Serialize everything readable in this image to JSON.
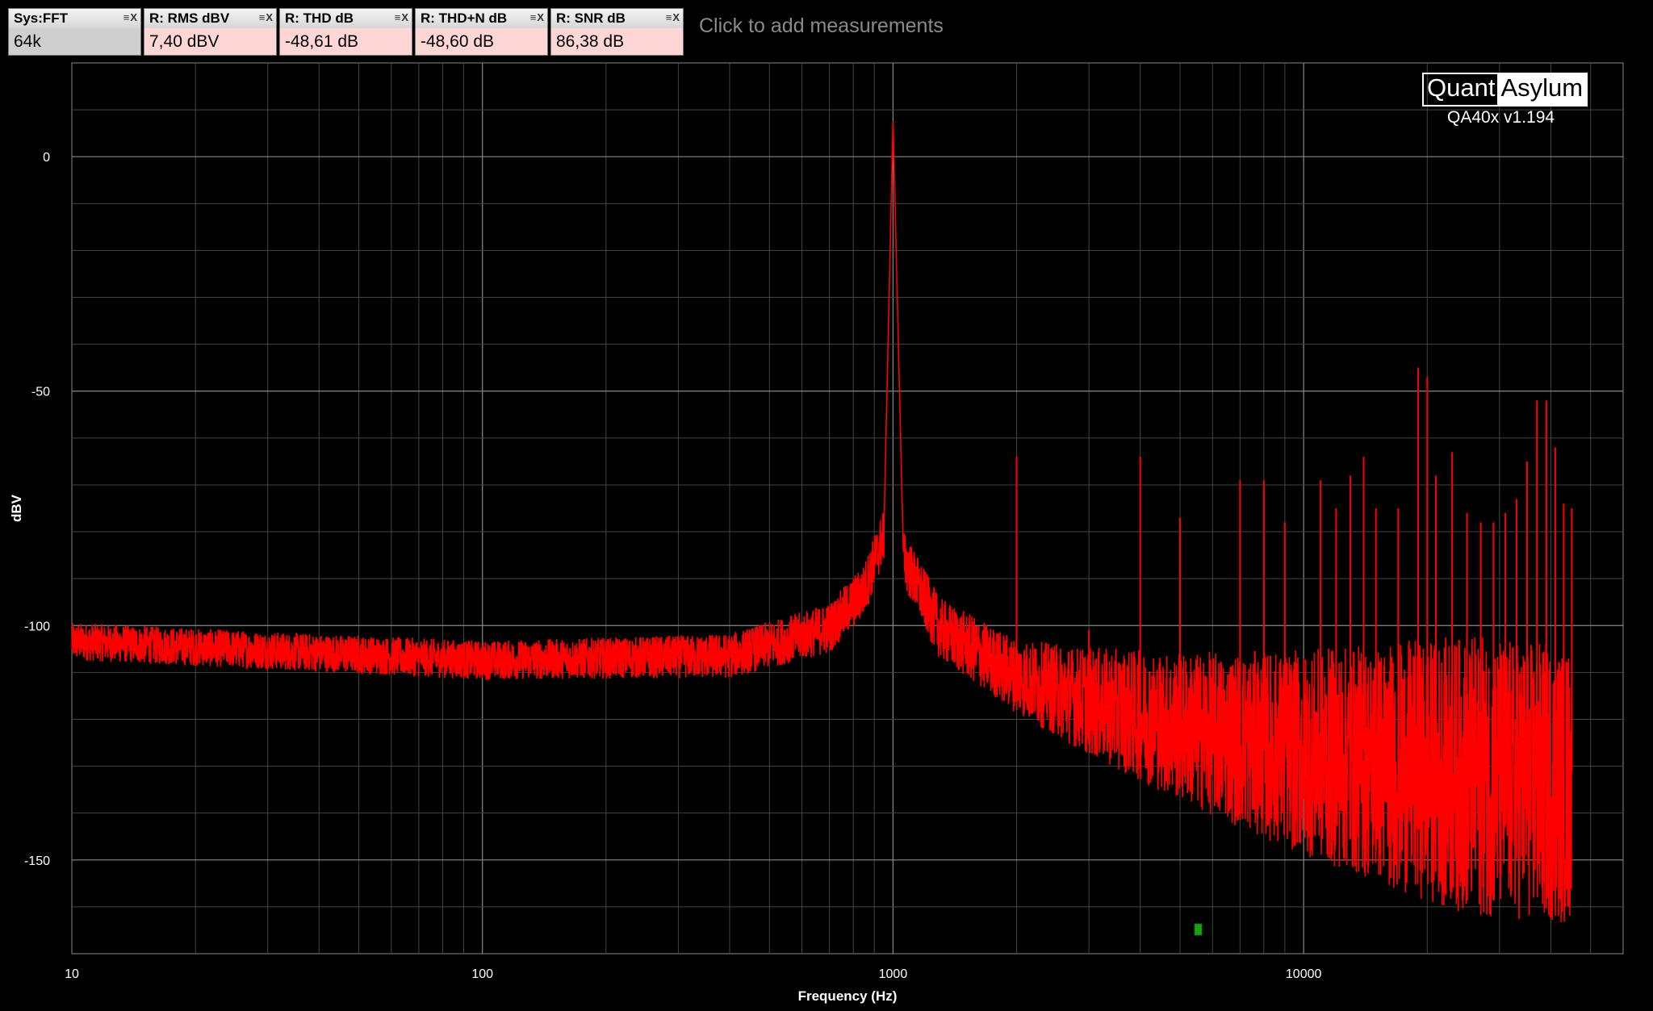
{
  "measurements": [
    {
      "title": "Sys:FFT",
      "value": "64k",
      "kind": "sys"
    },
    {
      "title": "R: RMS dBV",
      "value": "7,40 dBV",
      "kind": "res"
    },
    {
      "title": "R: THD dB",
      "value": "-48,61 dB",
      "kind": "res"
    },
    {
      "title": "R: THD+N dB",
      "value": "-48,60 dB",
      "kind": "res"
    },
    {
      "title": "R: SNR dB",
      "value": "86,38 dB",
      "kind": "res"
    }
  ],
  "add_measurements_label": "Click to add measurements",
  "logo": {
    "quant": "Quant",
    "asylum": "Asylum"
  },
  "version": "QA40x v1.194",
  "colors": {
    "trace": "#ff0000",
    "grid": "#666666",
    "background": "#000000"
  },
  "chart_data": {
    "type": "line",
    "xlabel": "Frequency (Hz)",
    "ylabel": "dBV",
    "x_scale": "log",
    "xlim": [
      10,
      60000
    ],
    "ylim": [
      -170,
      20
    ],
    "x_ticks": [
      {
        "value": 10,
        "label": "10"
      },
      {
        "value": 100,
        "label": "100"
      },
      {
        "value": 1000,
        "label": "1000"
      },
      {
        "value": 10000,
        "label": "10000"
      }
    ],
    "y_ticks": [
      {
        "value": 0,
        "label": "0"
      },
      {
        "value": -50,
        "label": "-50"
      },
      {
        "value": -100,
        "label": "-100"
      },
      {
        "value": -150,
        "label": "-150"
      }
    ],
    "grid": true,
    "series": [
      {
        "noise_floor": [
          [
            10,
            -103
          ],
          [
            100,
            -107
          ],
          [
            400,
            -106
          ],
          [
            700,
            -100
          ],
          [
            850,
            -92
          ],
          [
            950,
            -80
          ],
          [
            1000,
            8
          ],
          [
            1060,
            -85
          ],
          [
            1300,
            -100
          ],
          [
            2000,
            -110
          ],
          [
            3000,
            -115
          ],
          [
            5000,
            -120
          ],
          [
            10000,
            -125
          ],
          [
            20000,
            -128
          ],
          [
            45000,
            -131
          ]
        ],
        "harmonics": [
          {
            "freq": 1000,
            "dbv": 8
          },
          {
            "freq": 2000,
            "dbv": -64
          },
          {
            "freq": 3000,
            "dbv": -101
          },
          {
            "freq": 4000,
            "dbv": -64
          },
          {
            "freq": 5000,
            "dbv": -77
          },
          {
            "freq": 7000,
            "dbv": -69
          },
          {
            "freq": 8000,
            "dbv": -69
          },
          {
            "freq": 9000,
            "dbv": -78
          },
          {
            "freq": 11000,
            "dbv": -69
          },
          {
            "freq": 12000,
            "dbv": -75
          },
          {
            "freq": 13000,
            "dbv": -68
          },
          {
            "freq": 14000,
            "dbv": -64
          },
          {
            "freq": 15000,
            "dbv": -75
          },
          {
            "freq": 17000,
            "dbv": -75
          },
          {
            "freq": 19000,
            "dbv": -45
          },
          {
            "freq": 20000,
            "dbv": -47
          },
          {
            "freq": 21000,
            "dbv": -68
          },
          {
            "freq": 23000,
            "dbv": -63
          },
          {
            "freq": 25000,
            "dbv": -76
          },
          {
            "freq": 27000,
            "dbv": -78
          },
          {
            "freq": 29000,
            "dbv": -78
          },
          {
            "freq": 31000,
            "dbv": -76
          },
          {
            "freq": 33000,
            "dbv": -73
          },
          {
            "freq": 35000,
            "dbv": -65
          },
          {
            "freq": 37000,
            "dbv": -52
          },
          {
            "freq": 39000,
            "dbv": -52
          },
          {
            "freq": 41000,
            "dbv": -62
          },
          {
            "freq": 43000,
            "dbv": -74
          },
          {
            "freq": 45000,
            "dbv": -75
          }
        ]
      }
    ]
  }
}
